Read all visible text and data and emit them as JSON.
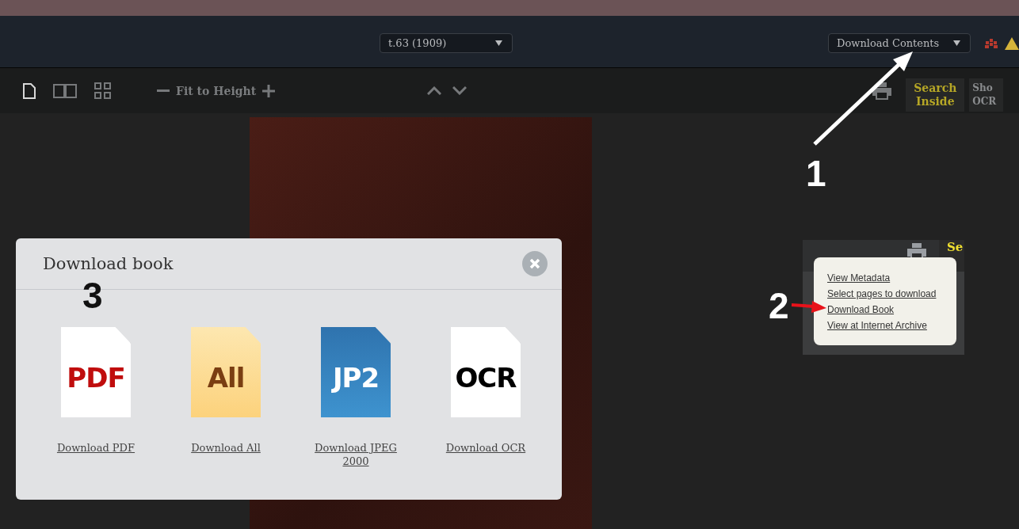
{
  "header": {
    "volume_select": "t.63 (1909)",
    "download_select": "Download Contents"
  },
  "toolbar": {
    "view_modes": [
      {
        "kind": "single",
        "selected": true
      },
      {
        "kind": "double",
        "selected": false
      },
      {
        "kind": "grid",
        "selected": false
      }
    ],
    "zoom_label": "Fit to Height",
    "search_button": [
      "Search",
      "Inside"
    ],
    "ocr_button": [
      "Sho",
      "OCR"
    ]
  },
  "modal": {
    "title": "Download book",
    "options": [
      {
        "kind": "pdf",
        "badge": "PDF",
        "label": "Download PDF"
      },
      {
        "kind": "all",
        "badge": "All",
        "label": "Download All"
      },
      {
        "kind": "jp2",
        "badge": "JP2",
        "label": "Download JPEG 2000"
      },
      {
        "kind": "ocr",
        "badge": "OCR",
        "label": "Download OCR"
      }
    ]
  },
  "inset": {
    "tab_lines": [
      "Se"
    ],
    "menu": [
      "View Metadata",
      "Select pages to download",
      "Download Book",
      "View at Internet Archive"
    ]
  },
  "annotations": [
    "1",
    "2",
    "3"
  ]
}
